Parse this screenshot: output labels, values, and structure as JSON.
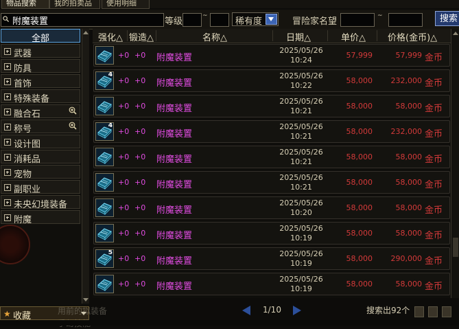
{
  "tabs": [
    {
      "label": "物品搜索",
      "active": true
    },
    {
      "label": "我的拍卖品",
      "active": false
    },
    {
      "label": "使用明细",
      "active": false
    }
  ],
  "search": {
    "query": "附魔装置",
    "level_label": "等级",
    "level_sep": "~",
    "rarity_value": "稀有度",
    "adventurer_label": "冒险家名望",
    "adventurer_sep": "~",
    "search_button": "搜索"
  },
  "sidebar": {
    "items": [
      {
        "label": "全部",
        "selected": true,
        "expandable": false,
        "zoom": false
      },
      {
        "label": "武器",
        "selected": false,
        "expandable": true,
        "zoom": false
      },
      {
        "label": "防具",
        "selected": false,
        "expandable": true,
        "zoom": false
      },
      {
        "label": "首饰",
        "selected": false,
        "expandable": true,
        "zoom": false
      },
      {
        "label": "特殊装备",
        "selected": false,
        "expandable": true,
        "zoom": false
      },
      {
        "label": "融合石",
        "selected": false,
        "expandable": true,
        "zoom": true
      },
      {
        "label": "称号",
        "selected": false,
        "expandable": true,
        "zoom": true
      },
      {
        "label": "设计图",
        "selected": false,
        "expandable": true,
        "zoom": false
      },
      {
        "label": "消耗品",
        "selected": false,
        "expandable": true,
        "zoom": false
      },
      {
        "label": "宠物",
        "selected": false,
        "expandable": true,
        "zoom": false
      },
      {
        "label": "副职业",
        "selected": false,
        "expandable": true,
        "zoom": false
      },
      {
        "label": "未央幻境装备",
        "selected": false,
        "expandable": true,
        "zoom": false
      },
      {
        "label": "附魔",
        "selected": false,
        "expandable": true,
        "zoom": false
      }
    ],
    "favorites_label": "收藏"
  },
  "table": {
    "headers": {
      "enhance": "强化△",
      "forge": "锻造△",
      "name": "名称△",
      "date": "日期△",
      "unit_price": "单价△",
      "price": "价格(金币)△"
    },
    "rows": [
      {
        "qty": "",
        "enhance": "+0",
        "forge": "+0",
        "name": "附魔装置",
        "date": "2025/05/26",
        "time": "10:24",
        "unit_price": "57,999",
        "price": "57,999",
        "currency": "金币"
      },
      {
        "qty": "4",
        "enhance": "+0",
        "forge": "+0",
        "name": "附魔装置",
        "date": "2025/05/26",
        "time": "10:22",
        "unit_price": "58,000",
        "price": "232,000",
        "currency": "金币"
      },
      {
        "qty": "",
        "enhance": "+0",
        "forge": "+0",
        "name": "附魔装置",
        "date": "2025/05/26",
        "time": "10:21",
        "unit_price": "58,000",
        "price": "58,000",
        "currency": "金币"
      },
      {
        "qty": "4",
        "enhance": "+0",
        "forge": "+0",
        "name": "附魔装置",
        "date": "2025/05/26",
        "time": "10:21",
        "unit_price": "58,000",
        "price": "232,000",
        "currency": "金币"
      },
      {
        "qty": "",
        "enhance": "+0",
        "forge": "+0",
        "name": "附魔装置",
        "date": "2025/05/26",
        "time": "10:21",
        "unit_price": "58,000",
        "price": "58,000",
        "currency": "金币"
      },
      {
        "qty": "",
        "enhance": "+0",
        "forge": "+0",
        "name": "附魔装置",
        "date": "2025/05/26",
        "time": "10:21",
        "unit_price": "58,000",
        "price": "58,000",
        "currency": "金币"
      },
      {
        "qty": "",
        "enhance": "+0",
        "forge": "+0",
        "name": "附魔装置",
        "date": "2025/05/26",
        "time": "10:20",
        "unit_price": "58,000",
        "price": "58,000",
        "currency": "金币"
      },
      {
        "qty": "",
        "enhance": "+0",
        "forge": "+0",
        "name": "附魔装置",
        "date": "2025/05/26",
        "time": "10:19",
        "unit_price": "58,000",
        "price": "58,000",
        "currency": "金币"
      },
      {
        "qty": "5",
        "enhance": "+0",
        "forge": "+0",
        "name": "附魔装置",
        "date": "2025/05/26",
        "time": "10:19",
        "unit_price": "58,000",
        "price": "290,000",
        "currency": "金币"
      },
      {
        "qty": "",
        "enhance": "+0",
        "forge": "+0",
        "name": "附魔装置",
        "date": "2025/05/26",
        "time": "10:19",
        "unit_price": "58,000",
        "price": "58,000",
        "currency": "金币"
      }
    ]
  },
  "pager": {
    "text": "1/10"
  },
  "results_text": "搜索出92个",
  "background_text": {
    "line1": "用前的拟装备",
    "line2": "手幻技能"
  },
  "colors": {
    "item_name": "#e04ce0",
    "price": "#d43a3a",
    "selected_border": "#5ca4e0",
    "search_button": "#243a6e"
  }
}
